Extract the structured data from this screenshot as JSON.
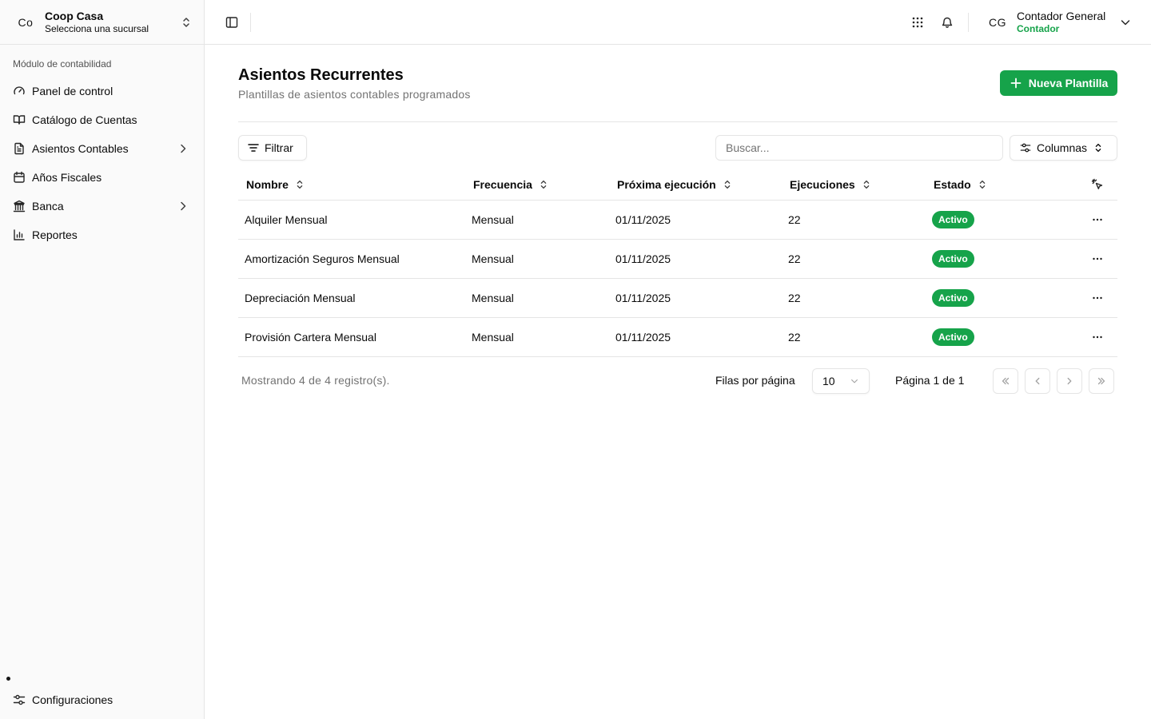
{
  "sidebar": {
    "org": {
      "initials": "Co",
      "name": "Coop Casa",
      "subtitle": "Selecciona una sucursal"
    },
    "section_label": "Módulo de contabilidad",
    "items": [
      {
        "label": "Panel de control",
        "icon": "gauge-icon"
      },
      {
        "label": "Catálogo de Cuentas",
        "icon": "book-open-icon"
      },
      {
        "label": "Asientos Contables",
        "icon": "file-text-icon",
        "expandable": true
      },
      {
        "label": "Años Fiscales",
        "icon": "calendar-icon"
      },
      {
        "label": "Banca",
        "icon": "bank-icon",
        "expandable": true
      },
      {
        "label": "Reportes",
        "icon": "bar-chart-icon"
      }
    ],
    "settings_label": "Configuraciones"
  },
  "topbar": {
    "user": {
      "initials": "CG",
      "name": "Contador General",
      "role": "Contador"
    }
  },
  "page": {
    "title": "Asientos Recurrentes",
    "subtitle": "Plantillas de asientos contables programados",
    "new_button": "Nueva Plantilla"
  },
  "toolbar": {
    "filter_label": "Filtrar",
    "search_placeholder": "Buscar...",
    "columns_label": "Columnas"
  },
  "table": {
    "headers": {
      "name": "Nombre",
      "frequency": "Frecuencia",
      "next_run": "Próxima ejecución",
      "executions": "Ejecuciones",
      "status": "Estado"
    },
    "rows": [
      {
        "name": "Alquiler Mensual",
        "frequency": "Mensual",
        "next_run": "01/11/2025",
        "executions": "22",
        "status": "Activo"
      },
      {
        "name": "Amortización Seguros Mensual",
        "frequency": "Mensual",
        "next_run": "01/11/2025",
        "executions": "22",
        "status": "Activo"
      },
      {
        "name": "Depreciación Mensual",
        "frequency": "Mensual",
        "next_run": "01/11/2025",
        "executions": "22",
        "status": "Activo"
      },
      {
        "name": "Provisión Cartera Mensual",
        "frequency": "Mensual",
        "next_run": "01/11/2025",
        "executions": "22",
        "status": "Activo"
      }
    ]
  },
  "pagination": {
    "showing": "Mostrando 4 de 4 registro(s).",
    "rows_per_page_label": "Filas por página",
    "rows_per_page_value": "10",
    "page_of": "Página 1 de 1"
  },
  "colors": {
    "accent": "#16a34a",
    "border": "#e5e5e5",
    "muted_text": "#737373",
    "sidebar_bg": "#fafafa"
  }
}
